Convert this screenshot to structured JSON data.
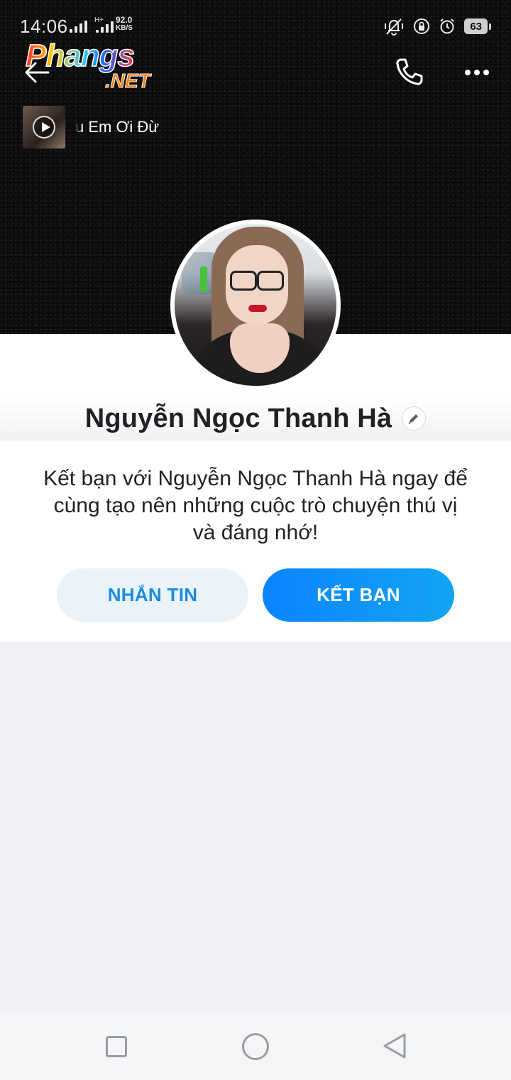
{
  "status_bar": {
    "time": "14:06",
    "network_type": "H+",
    "speed_value": "92.0",
    "speed_unit": "KB/S",
    "battery": "63"
  },
  "watermark": {
    "main": "Phangs",
    "sub": ".NET"
  },
  "music": {
    "text": "u        Em Ơi Đừ"
  },
  "profile": {
    "name": "Nguyễn Ngọc Thanh Hà",
    "prompt": "Kết bạn với Nguyễn Ngọc Thanh Hà ngay để cùng tạo nên những cuộc trò chuyện thú vị và đáng nhớ!"
  },
  "actions": {
    "message_label": "NHẮN TIN",
    "add_friend_label": "KẾT BẠN"
  },
  "colors": {
    "accent": "#0a84ff",
    "message_btn_bg": "#eaf3fa",
    "message_btn_text": "#1a8bdf",
    "page_bg": "#eff1f5"
  }
}
